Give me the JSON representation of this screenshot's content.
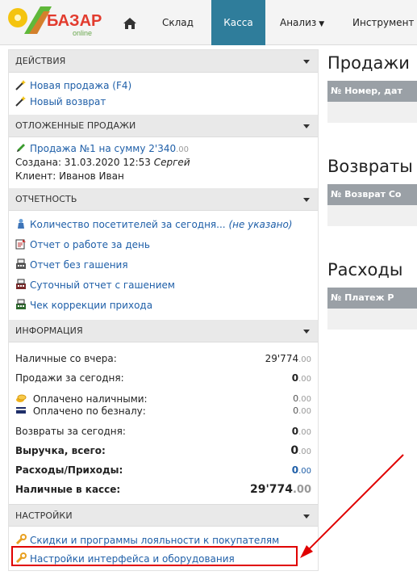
{
  "app": {
    "logo_text": "БАЗАР",
    "logo_sub": "online"
  },
  "nav": {
    "home_icon": "home-icon",
    "sklad": "Склад",
    "kassa": "Касса",
    "analiz": "Анализ",
    "tools": "Инструмент",
    "accent": "#2f7d9b"
  },
  "sections": {
    "actions": {
      "title": "ДЕЙСТВИЯ",
      "new_sale": "Новая продажа (F4)",
      "new_return": "Новый возврат"
    },
    "deferred": {
      "title": "ОТЛОЖЕННЫЕ ПРОДАЖИ",
      "sale_link": "Продажа №1 на сумму 2'340",
      "sale_cents": ".00",
      "created_label": "Создана: 31.03.2020 12:53",
      "created_user": "Сергей",
      "client": "Клиент: Иванов Иван"
    },
    "reports": {
      "title": "ОТЧЕТНОСТЬ",
      "visitors": "Количество посетителей за сегодня...",
      "visitors_status": "(не указано)",
      "day_report": "Отчет о работе за день",
      "no_zero_report": "Отчет без гашения",
      "daily_zero_report": "Суточный отчет с гашением",
      "correction_check": "Чек коррекции прихода"
    },
    "info": {
      "title": "ИНФОРМАЦИЯ",
      "cash_yesterday_label": "Наличные со вчера:",
      "cash_yesterday_int": "29'774",
      "cash_yesterday_cents": ".00",
      "sales_today_label": "Продажи за сегодня:",
      "sales_today_int": "0",
      "sales_today_cents": ".00",
      "paid_cash_label": "Оплачено наличными:",
      "paid_cash_int": "0",
      "paid_cash_cents": ".00",
      "paid_card_label": "Оплачено по безналу:",
      "paid_card_int": "0",
      "paid_card_cents": ".00",
      "returns_today_label": "Возвраты за сегодня:",
      "returns_today_int": "0",
      "returns_today_cents": ".00",
      "revenue_label": "Выручка, всего:",
      "revenue_int": "0",
      "revenue_cents": ".00",
      "expenses_label": "Расходы/Приходы:",
      "expenses_int": "0",
      "expenses_cents": ".00",
      "cash_in_register_label": "Наличные в кассе:",
      "cash_in_register_int": "29'774",
      "cash_in_register_cents": ".00"
    },
    "settings": {
      "title": "НАСТРОЙКИ",
      "discounts": "Скидки и программы лояльности к покупателям",
      "interface": "Настройки интерфейса и оборудования"
    }
  },
  "right": {
    "sales_title": "Продажи",
    "sales_header": "№ Номер, дат",
    "returns_title": "Возвраты",
    "returns_header": "№ Возврат Со",
    "expenses_title": "Расходы",
    "expenses_header": "№ Платеж Р"
  }
}
